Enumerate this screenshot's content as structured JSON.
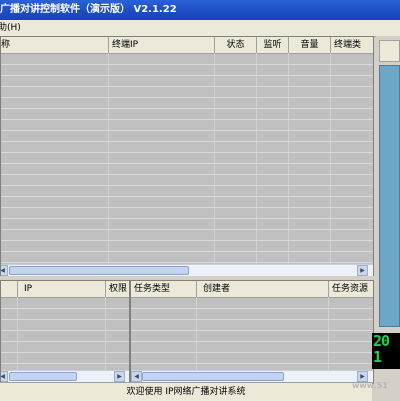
{
  "window": {
    "title": "广播对讲控制软件（演示版） V2.1.22"
  },
  "menu": {
    "help": "助(H)"
  },
  "terminal_table": {
    "columns": [
      "称",
      "终端IP",
      "状态",
      "监听",
      "音量",
      "终端类"
    ],
    "row_count": 20
  },
  "user_table": {
    "columns": [
      "",
      "IP",
      "权限"
    ],
    "row_count": 7
  },
  "task_table": {
    "columns": [
      "任务类型",
      "创建者",
      "任务资源"
    ],
    "row_count": 7
  },
  "clock": {
    "line1": "20",
    "line2": "1"
  },
  "statusbar": {
    "message": "欢迎使用 IP网络广播对讲系统"
  },
  "watermark": {
    "text": "www.51"
  },
  "colors": {
    "titlebar": "#1e4fc4",
    "grid_background": "#c0c0c0",
    "side_panel": "#6ea6c8",
    "clock_digits": "#1dd24a"
  }
}
